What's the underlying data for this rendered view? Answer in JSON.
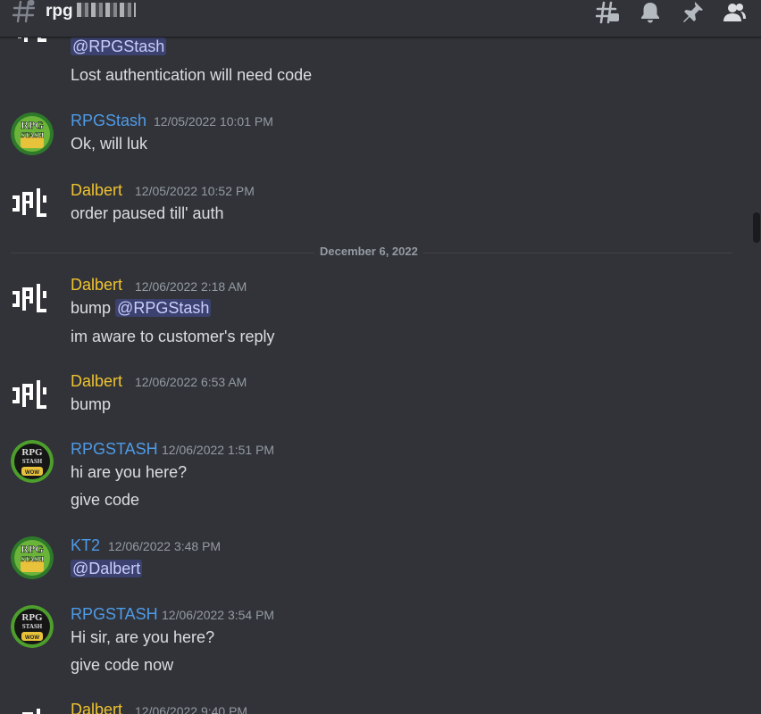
{
  "header": {
    "channel_name": "rpg",
    "icons": [
      "hash-threads-icon",
      "bell-icon",
      "pin-icon",
      "members-icon"
    ]
  },
  "date_divider": "December 6, 2022",
  "messages": [
    {
      "id": "m0",
      "author": "",
      "timestamp": "",
      "lines": [
        "@RPGStash",
        "Lost authentication will need code"
      ]
    },
    {
      "id": "m1",
      "author": "RPGStash",
      "timestamp": "12/05/2022 10:01 PM",
      "lines": [
        "Ok, will luk"
      ]
    },
    {
      "id": "m2",
      "author": "Dalbert",
      "timestamp": "12/05/2022 10:52 PM",
      "lines": [
        "order paused till' auth"
      ]
    },
    {
      "id": "m3",
      "author": "Dalbert",
      "timestamp": "12/06/2022 2:18 AM",
      "lines": [
        "bump",
        "@RPGStash",
        "im aware to customer's reply"
      ]
    },
    {
      "id": "m4",
      "author": "Dalbert",
      "timestamp": "12/06/2022 6:53 AM",
      "lines": [
        "bump"
      ]
    },
    {
      "id": "m5",
      "author": "RPGSTASH",
      "timestamp": "12/06/2022 1:51 PM",
      "lines": [
        "hi are you here?",
        "give code"
      ]
    },
    {
      "id": "m6",
      "author": "KT2",
      "timestamp": "12/06/2022 3:48 PM",
      "lines": [
        "@Dalbert"
      ]
    },
    {
      "id": "m7",
      "author": "RPGSTASH",
      "timestamp": "12/06/2022 3:54 PM",
      "lines": [
        "Hi sir, are you here?",
        "give code now"
      ]
    },
    {
      "id": "m8",
      "author": "Dalbert",
      "timestamp": "12/06/2022 9:40 PM",
      "lines": []
    }
  ],
  "avatars": {
    "rpg_stash_text": [
      "RPG",
      "STASH"
    ],
    "rpg_stash_wow_text": [
      "RPG",
      "STASH",
      "WOW"
    ]
  },
  "colors": {
    "background": "#313338",
    "dalbert": "#f0c330",
    "rpgstash": "#4f9be8",
    "mention_bg": "#3c4270",
    "mention_text": "#c9cdfb"
  }
}
